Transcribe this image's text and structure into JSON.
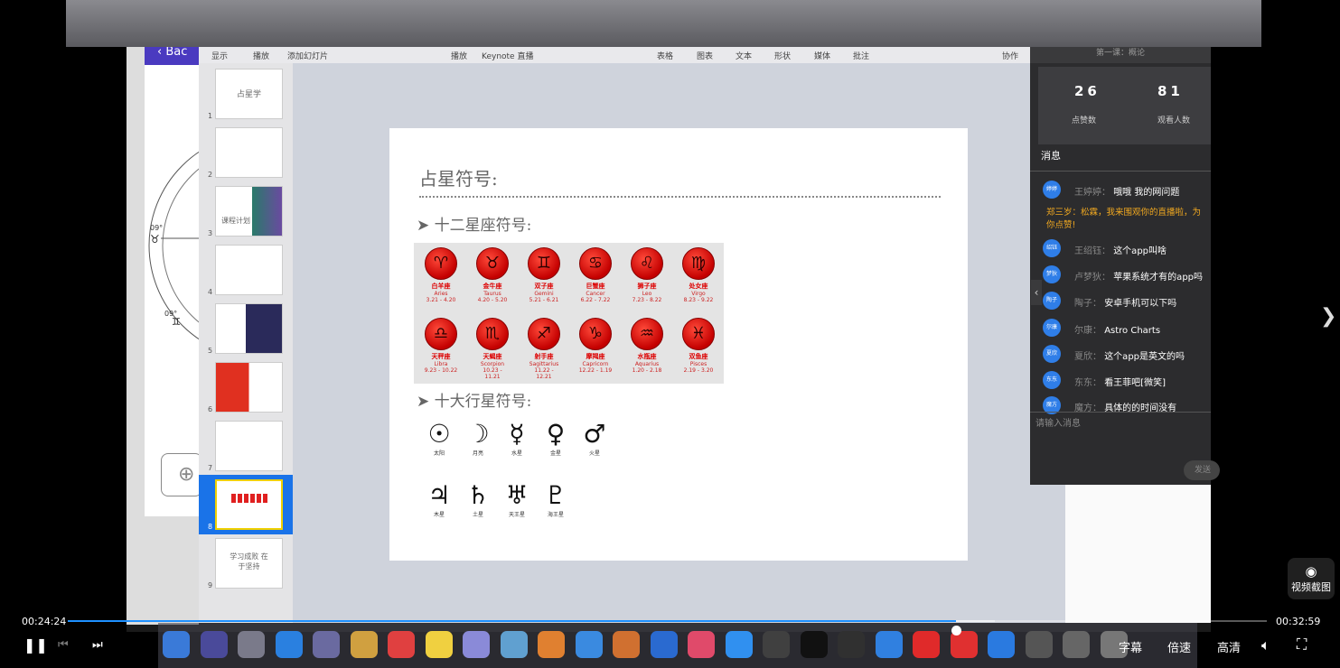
{
  "keynote": {
    "back_label": "Bac",
    "toolbar": [
      "显示",
      "播放",
      "添加幻灯片",
      "播放",
      "Keynote 直播",
      "表格",
      "图表",
      "文本",
      "形状",
      "媒体",
      "批注",
      "协作"
    ],
    "thumbnails": [
      {
        "num": "1",
        "text": "占星学"
      },
      {
        "num": "2",
        "text": ""
      },
      {
        "num": "3",
        "text": "课程计划"
      },
      {
        "num": "4",
        "text": ""
      },
      {
        "num": "5",
        "text": ""
      },
      {
        "num": "6",
        "text": ""
      },
      {
        "num": "7",
        "text": ""
      },
      {
        "num": "8",
        "text": ""
      },
      {
        "num": "9",
        "text": "学习成败 在于坚持"
      }
    ],
    "selected_slide": "8"
  },
  "slide": {
    "title": "占星符号:",
    "bullet1": "➤ 十二星座符号:",
    "bullet2": "➤ 十大行星符号:",
    "zodiac": [
      {
        "glyph": "♈",
        "name": "白羊座",
        "en": "Aries",
        "date": "3.21 - 4.20"
      },
      {
        "glyph": "♉",
        "name": "金牛座",
        "en": "Taurus",
        "date": "4.20 - 5.20"
      },
      {
        "glyph": "♊",
        "name": "双子座",
        "en": "Gemini",
        "date": "5.21 - 6.21"
      },
      {
        "glyph": "♋",
        "name": "巨蟹座",
        "en": "Cancer",
        "date": "6.22 - 7.22"
      },
      {
        "glyph": "♌",
        "name": "狮子座",
        "en": "Leo",
        "date": "7.23 - 8.22"
      },
      {
        "glyph": "♍",
        "name": "处女座",
        "en": "Virgo",
        "date": "8.23 - 9.22"
      },
      {
        "glyph": "♎",
        "name": "天秤座",
        "en": "Libra",
        "date": "9.23 - 10.22"
      },
      {
        "glyph": "♏",
        "name": "天蝎座",
        "en": "Scorpion",
        "date": "10.23 - 11.21"
      },
      {
        "glyph": "♐",
        "name": "射手座",
        "en": "Sagittarius",
        "date": "11.22 - 12.21"
      },
      {
        "glyph": "♑",
        "name": "摩羯座",
        "en": "Capricorn",
        "date": "12.22 - 1.19"
      },
      {
        "glyph": "♒",
        "name": "水瓶座",
        "en": "Aquarius",
        "date": "1.20 - 2.18"
      },
      {
        "glyph": "♓",
        "name": "双鱼座",
        "en": "Pisces",
        "date": "2.19 - 3.20"
      }
    ],
    "planets": [
      {
        "glyph": "☉",
        "name": "太阳"
      },
      {
        "glyph": "☽",
        "name": "月亮"
      },
      {
        "glyph": "☿",
        "name": "水星"
      },
      {
        "glyph": "♀",
        "name": "金星"
      },
      {
        "glyph": "♂",
        "name": "火星"
      },
      {
        "glyph": "♃",
        "name": "木星"
      },
      {
        "glyph": "♄",
        "name": "土星"
      },
      {
        "glyph": "♅",
        "name": "天王星"
      },
      {
        "glyph": "♇",
        "name": "海王星"
      }
    ]
  },
  "live_panel": {
    "header": "第一课：概论",
    "likes_value": "26",
    "likes_label": "点赞数",
    "viewers_value": "81",
    "viewers_label": "观看人数",
    "messages_title": "消息",
    "highlight": "郑三岁：松霖，我来围观你的直播啦，为你点赞!",
    "messages": [
      {
        "avatar": "婷婷",
        "name": "王婷婷",
        "text": "哦哦 我的网问题"
      },
      {
        "avatar": "绍钰",
        "name": "王绍钰",
        "text": "这个app叫啥"
      },
      {
        "avatar": "梦狄",
        "name": "卢梦狄",
        "text": "苹果系统才有的app吗"
      },
      {
        "avatar": "陶子",
        "name": "陶子",
        "text": "安卓手机可以下吗"
      },
      {
        "avatar": "尔康",
        "name": "尔康",
        "text": "Astro Charts"
      },
      {
        "avatar": "夏欣",
        "name": "夏欣",
        "text": "这个app是英文的吗"
      },
      {
        "avatar": "东东",
        "name": "东东",
        "text": "看王菲吧[微笑]"
      },
      {
        "avatar": "魔方",
        "name": "魔方",
        "text": "具体的的时间没有"
      }
    ],
    "input_placeholder": "请输入消息",
    "send_label": "发送"
  },
  "player": {
    "current_time": "00:24:24",
    "total_time": "00:32:59",
    "progress": 0.741,
    "buffered": 0.773,
    "subtitle_label": "字幕",
    "speed_label": "倍速",
    "quality_label": "高清",
    "screenshot_label": "视频截图"
  }
}
